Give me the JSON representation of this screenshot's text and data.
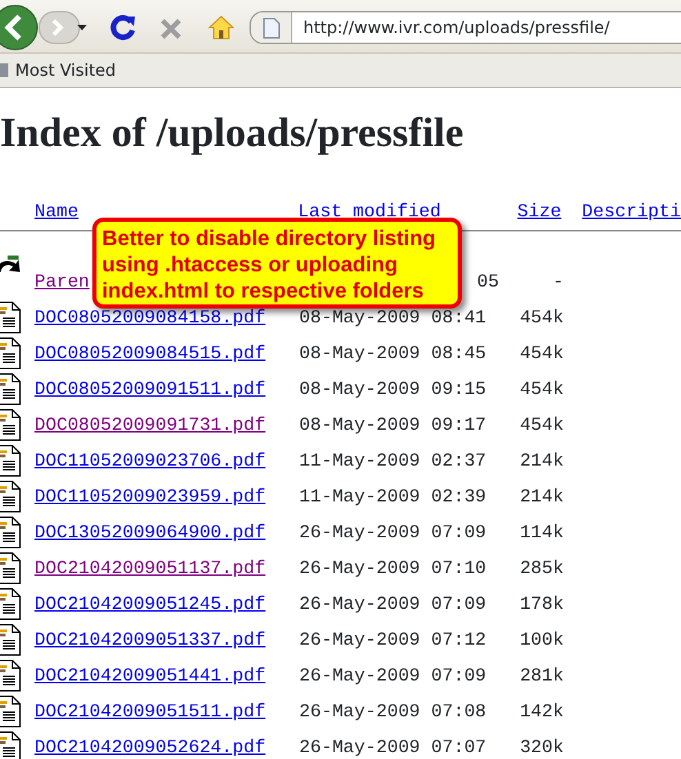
{
  "toolbar": {
    "url": "http://www.ivr.com/uploads/pressfile/"
  },
  "bookmarks": [
    {
      "label": "Most Visited"
    }
  ],
  "heading": "Index of /uploads/pressfile",
  "columns": [
    {
      "label": "Name"
    },
    {
      "label": "Last modified"
    },
    {
      "label": "Size"
    },
    {
      "label": "Descripti"
    }
  ],
  "rows": [
    {
      "kind": "parent",
      "name": "Paren",
      "visited": true,
      "modified": "05",
      "size": "-"
    },
    {
      "kind": "file",
      "name": "DOC08052009084158.pdf",
      "visited": false,
      "modified": "08-May-2009 08:41",
      "size": "454k"
    },
    {
      "kind": "file",
      "name": "DOC08052009084515.pdf",
      "visited": false,
      "modified": "08-May-2009 08:45",
      "size": "454k"
    },
    {
      "kind": "file",
      "name": "DOC08052009091511.pdf",
      "visited": false,
      "modified": "08-May-2009 09:15",
      "size": "454k"
    },
    {
      "kind": "file",
      "name": "DOC08052009091731.pdf",
      "visited": true,
      "modified": "08-May-2009 09:17",
      "size": "454k"
    },
    {
      "kind": "file",
      "name": "DOC11052009023706.pdf",
      "visited": false,
      "modified": "11-May-2009 02:37",
      "size": "214k"
    },
    {
      "kind": "file",
      "name": "DOC11052009023959.pdf",
      "visited": false,
      "modified": "11-May-2009 02:39",
      "size": "214k"
    },
    {
      "kind": "file",
      "name": "DOC13052009064900.pdf",
      "visited": false,
      "modified": "26-May-2009 07:09",
      "size": "114k"
    },
    {
      "kind": "file",
      "name": "DOC21042009051137.pdf",
      "visited": true,
      "modified": "26-May-2009 07:10",
      "size": "285k"
    },
    {
      "kind": "file",
      "name": "DOC21042009051245.pdf",
      "visited": false,
      "modified": "26-May-2009 07:09",
      "size": "178k"
    },
    {
      "kind": "file",
      "name": "DOC21042009051337.pdf",
      "visited": false,
      "modified": "26-May-2009 07:12",
      "size": "100k"
    },
    {
      "kind": "file",
      "name": "DOC21042009051441.pdf",
      "visited": false,
      "modified": "26-May-2009 07:09",
      "size": "281k"
    },
    {
      "kind": "file",
      "name": "DOC21042009051511.pdf",
      "visited": false,
      "modified": "26-May-2009 07:08",
      "size": "142k"
    },
    {
      "kind": "file",
      "name": "DOC21042009052624.pdf",
      "visited": false,
      "modified": "26-May-2009 07:07",
      "size": "320k"
    }
  ],
  "callout": "Better to disable directory listing using .htaccess or uploading index.html to respective folders"
}
